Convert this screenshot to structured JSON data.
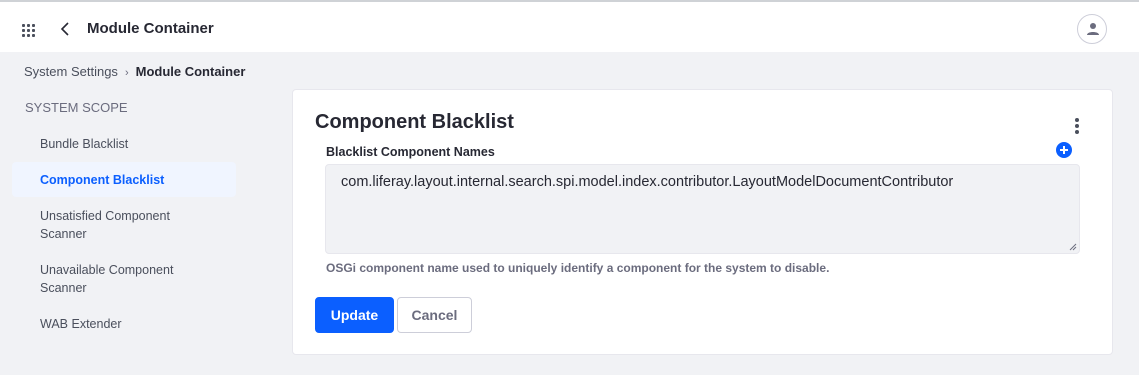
{
  "header": {
    "title": "Module Container",
    "apps_icon": "grid-icon",
    "back_icon": "chevron-left-icon",
    "user_icon": "user-icon"
  },
  "breadcrumb": {
    "items": [
      "System Settings",
      "Module Container"
    ],
    "separator_icon": "chevron-right-icon"
  },
  "sidebar": {
    "scope_label": "SYSTEM SCOPE",
    "items": [
      {
        "label": "Bundle Blacklist",
        "active": false
      },
      {
        "label": "Component Blacklist",
        "active": true
      },
      {
        "label": "Unsatisfied Component Scanner",
        "active": false
      },
      {
        "label": "Unavailable Component Scanner",
        "active": false
      },
      {
        "label": "WAB Extender",
        "active": false
      }
    ]
  },
  "form": {
    "title": "Component Blacklist",
    "menu_icon": "kebab-icon",
    "field_label": "Blacklist Component Names",
    "add_icon": "plus-circle-icon",
    "field_value": "com.liferay.layout.internal.search.spi.model.index.contributor.LayoutModelDocumentContributor",
    "help_text": "OSGi component name used to uniquely identify a component for the system to disable.",
    "update_label": "Update",
    "cancel_label": "Cancel"
  },
  "colors": {
    "accent": "#0b5fff",
    "background": "#f1f2f5",
    "text": "#272833",
    "muted": "#6b6c7e"
  }
}
